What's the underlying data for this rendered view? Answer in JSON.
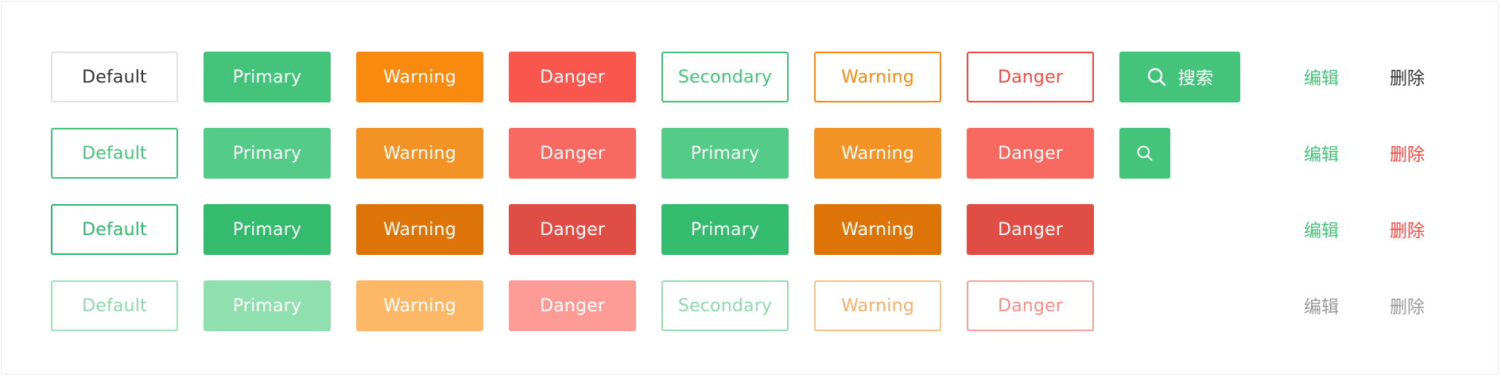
{
  "colors": {
    "primary": "#44c47a",
    "warning": "#f78a0f",
    "danger": "#f9574e",
    "text_dark": "#333333",
    "text_gray": "#999999"
  },
  "rows": [
    {
      "default": "Default",
      "primary": "Primary",
      "warning": "Warning",
      "danger": "Danger",
      "secondary_outline": "Secondary",
      "warning_outline": "Warning",
      "danger_outline": "Danger",
      "search": {
        "icon": "search-icon",
        "label": "搜索"
      },
      "edit": "编辑",
      "delete": "删除"
    },
    {
      "default": "Default",
      "primary": "Primary",
      "warning": "Warning",
      "danger": "Danger",
      "primary2": "Primary",
      "warning2": "Warning",
      "danger2": "Danger",
      "icon_only": {
        "icon": "search-icon"
      },
      "edit": "编辑",
      "delete": "删除"
    },
    {
      "default": "Default",
      "primary": "Primary",
      "warning": "Warning",
      "danger": "Danger",
      "primary2": "Primary",
      "warning2": "Warning",
      "danger2": "Danger",
      "edit": "编辑",
      "delete": "删除"
    },
    {
      "default": "Default",
      "primary": "Primary",
      "warning": "Warning",
      "danger": "Danger",
      "secondary_outline": "Secondary",
      "warning_outline": "Warning",
      "danger_outline": "Danger",
      "edit": "编辑",
      "delete": "删除"
    }
  ]
}
